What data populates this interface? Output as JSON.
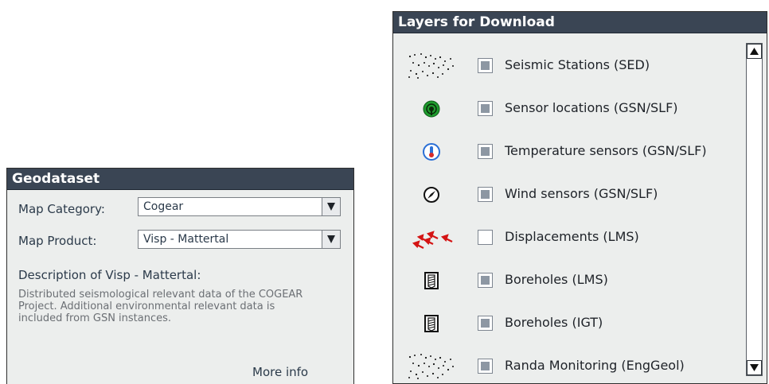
{
  "geodataset": {
    "title": "Geodataset",
    "map_category_label": "Map Category:",
    "map_category_value": "Cogear",
    "map_product_label": "Map Product:",
    "map_product_value": "Visp - Mattertal",
    "description_title": "Description of Visp - Mattertal:",
    "description_body": "Distributed seismological relevant data of the COGEAR Project. Additional environmental relevant data is included from GSN instances.",
    "more_info": "More info"
  },
  "layers": {
    "title": "Layers for Download",
    "items": [
      {
        "label": "Seismic Stations (SED)",
        "checked": true,
        "icon": "dots-icon"
      },
      {
        "label": "Sensor locations (GSN/SLF)",
        "checked": true,
        "icon": "antenna-icon"
      },
      {
        "label": "Temperature sensors (GSN/SLF)",
        "checked": true,
        "icon": "thermometer-icon"
      },
      {
        "label": "Wind sensors (GSN/SLF)",
        "checked": true,
        "icon": "compass-icon"
      },
      {
        "label": "Displacements (LMS)",
        "checked": false,
        "icon": "arrows-icon"
      },
      {
        "label": "Boreholes (LMS)",
        "checked": true,
        "icon": "borehole-icon"
      },
      {
        "label": "Boreholes (IGT)",
        "checked": true,
        "icon": "borehole-icon"
      },
      {
        "label": "Randa Monitoring (EngGeol)",
        "checked": true,
        "icon": "dots-icon"
      }
    ]
  }
}
